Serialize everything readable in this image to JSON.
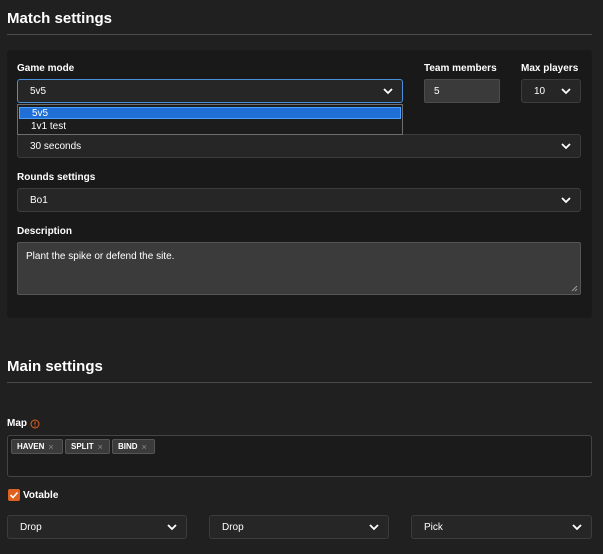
{
  "match_settings": {
    "title": "Match settings",
    "game_mode": {
      "label": "Game mode",
      "value": "5v5",
      "options": [
        "5v5",
        "1v1 test"
      ]
    },
    "team_members": {
      "label": "Team members",
      "value": "5"
    },
    "max_players": {
      "label": "Max players",
      "value": "10"
    },
    "round_time": {
      "value": "30 seconds"
    },
    "rounds_settings": {
      "label": "Rounds settings",
      "value": "Bo1"
    },
    "description": {
      "label": "Description",
      "value": "Plant the spike or defend the site."
    }
  },
  "main_settings": {
    "title": "Main settings",
    "map": {
      "label": "Map",
      "tags": [
        "HAVEN",
        "SPLIT",
        "BIND"
      ],
      "tag_remove_glyph": "×"
    },
    "votable": {
      "label": "Votable",
      "checked": true
    },
    "picks": [
      "Drop",
      "Drop",
      "Pick"
    ]
  },
  "colors": {
    "accent": "#e0601f",
    "focus": "#4a90d9",
    "selected_option": "#1f6fd6"
  },
  "icons": {
    "caret": "chevron-down-icon",
    "info": "info-icon",
    "check": "check-icon"
  }
}
